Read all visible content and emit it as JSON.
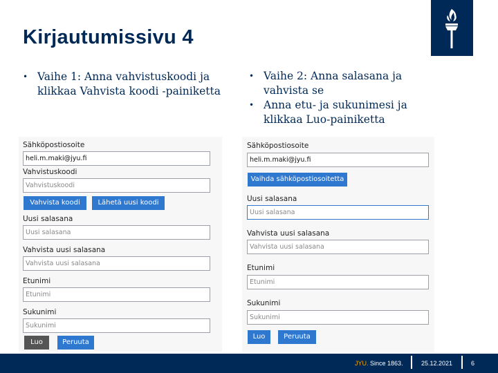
{
  "title": "Kirjautumissivu 4",
  "bullets_left": [
    "Vaihe 1: Anna vahvistuskoodi ja klikkaa Vahvista koodi -painiketta"
  ],
  "bullets_right": [
    "Vaihe 2: Anna salasana ja vahvista se",
    "Anna etu- ja sukunimesi ja klikkaa Luo-painiketta"
  ],
  "left_form": {
    "email_label": "Sähköpostiosoite",
    "email_value": "heli.m.maki@jyu.fi",
    "code_label": "Vahvistuskoodi",
    "code_placeholder": "Vahvistuskoodi",
    "verify_button": "Vahvista koodi",
    "resend_button": "Lähetä uusi koodi",
    "new_password_label": "Uusi salasana",
    "new_password_placeholder": "Uusi salasana",
    "confirm_password_label": "Vahvista uusi salasana",
    "confirm_password_placeholder": "Vahvista uusi salasana",
    "first_name_label": "Etunimi",
    "first_name_placeholder": "Etunimi",
    "last_name_label": "Sukunimi",
    "last_name_placeholder": "Sukunimi",
    "create_button": "Luo",
    "cancel_button": "Peruuta"
  },
  "right_form": {
    "email_label": "Sähköpostiosoite",
    "email_value": "heli.m.maki@jyu.fi",
    "change_email_button": "Vaihda sähköpostiosoitetta",
    "new_password_label": "Uusi salasana",
    "new_password_placeholder": "Uusi salasana",
    "confirm_password_label": "Vahvista uusi salasana",
    "confirm_password_placeholder": "Vahvista uusi salasana",
    "first_name_label": "Etunimi",
    "first_name_placeholder": "Etunimi",
    "last_name_label": "Sukunimi",
    "last_name_placeholder": "Sukunimi",
    "create_button": "Luo",
    "cancel_button": "Peruuta"
  },
  "footer": {
    "brand": "JYU.",
    "since": "Since 1863.",
    "date": "25.12.2021",
    "page": "6"
  },
  "colors": {
    "brand_navy": "#002957",
    "button_blue": "#2f78d0",
    "button_grey": "#555555",
    "accent_orange": "#f5a100"
  },
  "icons": {
    "logo": "torch-logo-icon"
  }
}
